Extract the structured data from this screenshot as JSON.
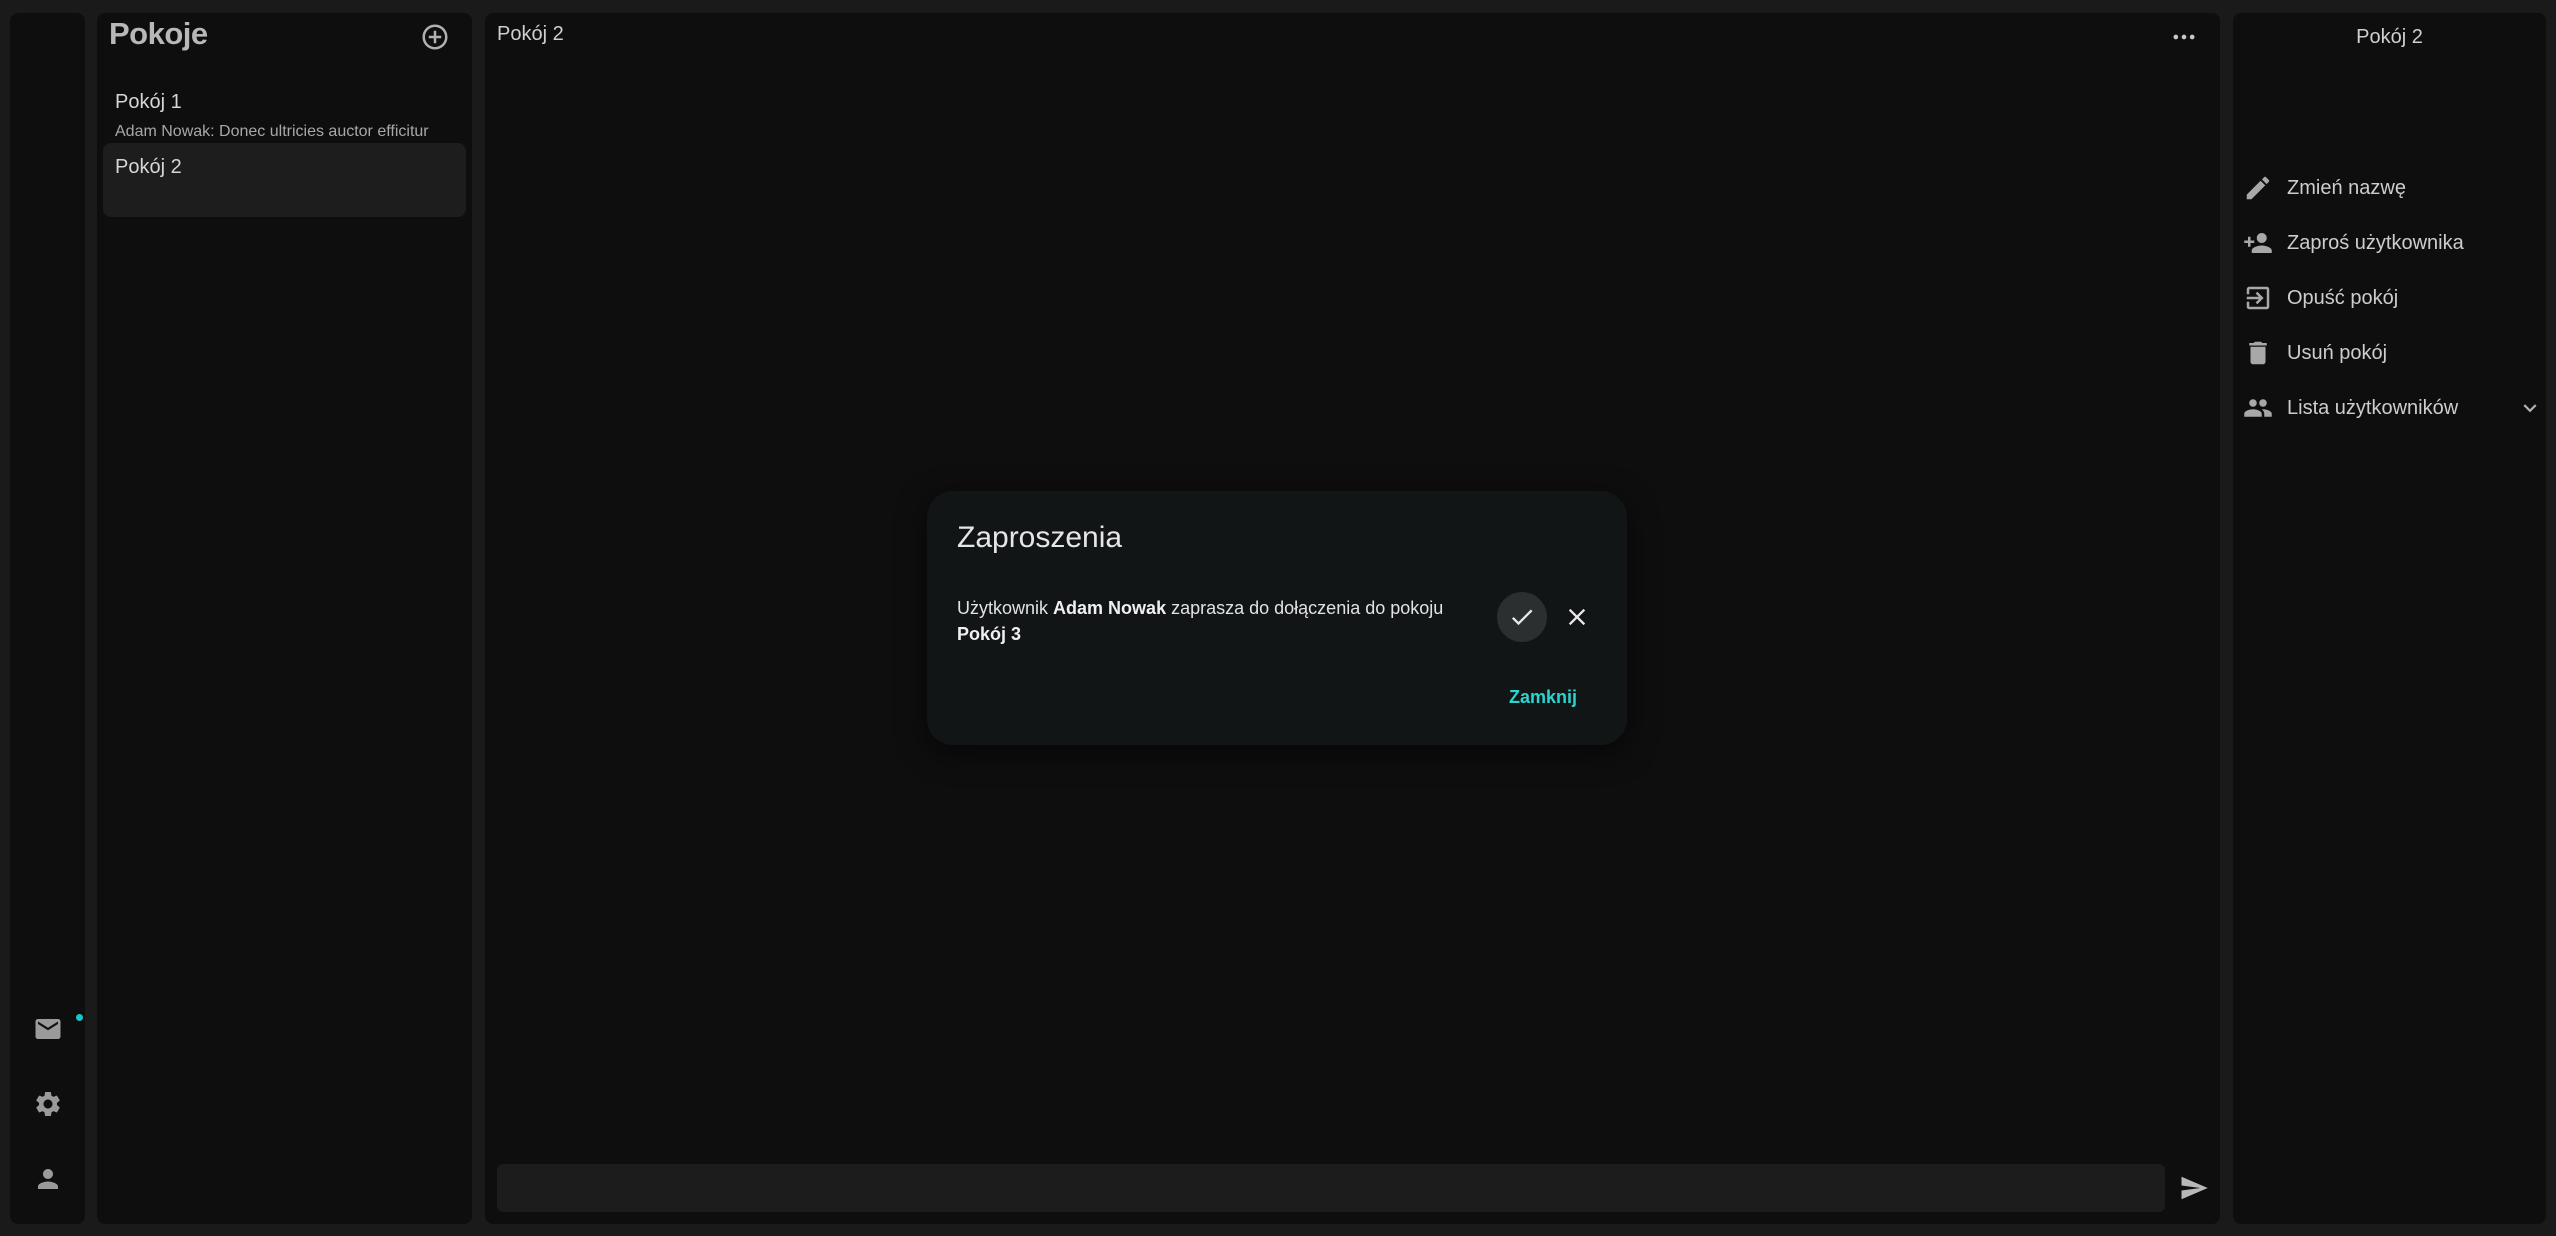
{
  "rail": {
    "icons": [
      "mail-icon",
      "settings-icon",
      "user-icon"
    ],
    "notification_color": "#19c4c4"
  },
  "rooms_panel": {
    "title": "Pokoje",
    "rooms": [
      {
        "name": "Pokój 1",
        "preview": "Adam Nowak: Donec ultricies auctor efficitur"
      },
      {
        "name": "Pokój 2",
        "preview": ""
      }
    ],
    "active_room": "Pokój 2"
  },
  "chat": {
    "title": "Pokój 2",
    "input_placeholder": ""
  },
  "details": {
    "title": "Pokój 2",
    "actions": [
      {
        "label": "Zmień nazwę",
        "icon": "pencil-icon"
      },
      {
        "label": "Zaproś użytkownika",
        "icon": "person-add-icon"
      },
      {
        "label": "Opuść pokój",
        "icon": "exit-icon"
      },
      {
        "label": "Usuń pokój",
        "icon": "trash-icon"
      },
      {
        "label": "Lista użytkowników",
        "icon": "people-icon"
      }
    ]
  },
  "dialog": {
    "title": "Zaproszenia",
    "invite_prefix": "Użytkownik",
    "invite_user": "Adam Nowak",
    "invite_middle": "zaprasza do dołączenia do pokoju",
    "invite_room": "Pokój 3",
    "close_label": "Zamknij"
  },
  "colors": {
    "accent": "#2ad4cf",
    "background": "#1a1a1a",
    "panel": "#0e0e0e"
  }
}
